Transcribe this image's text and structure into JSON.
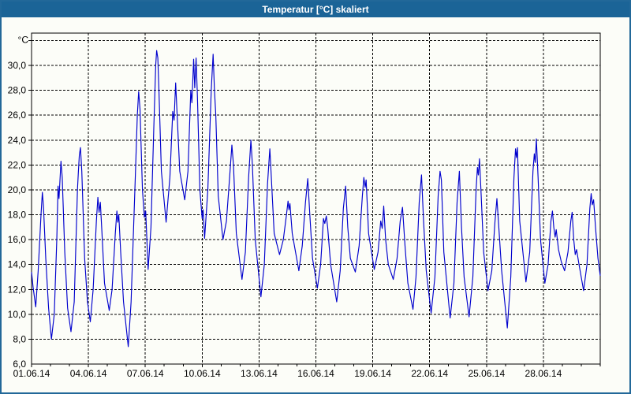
{
  "window": {
    "title": "Temperatur [°C] skaliert",
    "colors": {
      "titlebar": "#1B6497",
      "border": "#226899",
      "background": "#FCFDF8",
      "title_text": "#FFFFFF"
    }
  },
  "chart_data": {
    "type": "line",
    "title": "Temperatur [°C] skaliert",
    "grid": {
      "style": "dashed",
      "color": "#000000"
    },
    "x_axis": {
      "tick_labels": [
        "01.06.14",
        "04.06.14",
        "07.06.14",
        "10.06.14",
        "13.06.14",
        "16.06.14",
        "19.06.14",
        "22.06.14",
        "25.06.14",
        "28.06.14"
      ],
      "tick_days": [
        0,
        3,
        6,
        9,
        12,
        15,
        18,
        21,
        24,
        27
      ],
      "minor_tick_every_days": 1,
      "range_days": [
        0,
        30
      ]
    },
    "y_axis": {
      "unit": "°C",
      "tick_labels": [
        "30,0",
        "28,0",
        "26,0",
        "24,0",
        "22,0",
        "20,0",
        "18,0",
        "16,0",
        "14,0",
        "12,0",
        "10,0",
        "8,0",
        "6,0"
      ],
      "tick_values": [
        30,
        28,
        26,
        24,
        22,
        20,
        18,
        16,
        14,
        12,
        10,
        8,
        6
      ],
      "gridline_values": [
        8,
        10,
        12,
        14,
        16,
        18,
        20,
        22,
        24,
        26,
        28,
        30,
        32
      ],
      "range": [
        6,
        32.6
      ]
    },
    "series": [
      {
        "name": "Temperatur",
        "color": "#0000CD",
        "points": [
          [
            0.0,
            13.4
          ],
          [
            0.08,
            12.2
          ],
          [
            0.22,
            10.6
          ],
          [
            0.35,
            13.5
          ],
          [
            0.5,
            18.0
          ],
          [
            0.57,
            19.8
          ],
          [
            0.63,
            18.7
          ],
          [
            0.75,
            14.5
          ],
          [
            0.9,
            10.5
          ],
          [
            1.05,
            8.0
          ],
          [
            1.2,
            10.0
          ],
          [
            1.33,
            16.0
          ],
          [
            1.4,
            20.3
          ],
          [
            1.45,
            19.3
          ],
          [
            1.55,
            22.3
          ],
          [
            1.62,
            21.0
          ],
          [
            1.75,
            15.0
          ],
          [
            1.9,
            10.5
          ],
          [
            2.08,
            8.6
          ],
          [
            2.25,
            11.0
          ],
          [
            2.42,
            20.0
          ],
          [
            2.47,
            21.5
          ],
          [
            2.52,
            22.8
          ],
          [
            2.58,
            23.4
          ],
          [
            2.65,
            21.5
          ],
          [
            2.8,
            14.5
          ],
          [
            2.95,
            11.0
          ],
          [
            3.1,
            9.4
          ],
          [
            3.25,
            12.0
          ],
          [
            3.42,
            17.5
          ],
          [
            3.5,
            19.4
          ],
          [
            3.56,
            18.2
          ],
          [
            3.63,
            19.0
          ],
          [
            3.7,
            17.0
          ],
          [
            3.85,
            12.5
          ],
          [
            4.1,
            10.3
          ],
          [
            4.25,
            12.0
          ],
          [
            4.42,
            16.5
          ],
          [
            4.5,
            18.3
          ],
          [
            4.55,
            17.4
          ],
          [
            4.6,
            18.0
          ],
          [
            4.7,
            15.0
          ],
          [
            4.85,
            11.0
          ],
          [
            5.1,
            7.4
          ],
          [
            5.25,
            11.0
          ],
          [
            5.45,
            20.0
          ],
          [
            5.58,
            26.0
          ],
          [
            5.65,
            27.9
          ],
          [
            5.72,
            26.5
          ],
          [
            5.85,
            20.0
          ],
          [
            5.95,
            17.8
          ],
          [
            6.02,
            18.3
          ],
          [
            6.15,
            13.6
          ],
          [
            6.3,
            17.0
          ],
          [
            6.45,
            25.0
          ],
          [
            6.55,
            30.0
          ],
          [
            6.6,
            31.2
          ],
          [
            6.66,
            30.6
          ],
          [
            6.72,
            28.0
          ],
          [
            6.85,
            21.5
          ],
          [
            7.1,
            17.4
          ],
          [
            7.3,
            21.0
          ],
          [
            7.45,
            26.3
          ],
          [
            7.52,
            25.6
          ],
          [
            7.6,
            28.6
          ],
          [
            7.68,
            26.0
          ],
          [
            7.82,
            21.5
          ],
          [
            8.08,
            19.2
          ],
          [
            8.25,
            21.5
          ],
          [
            8.4,
            28.0
          ],
          [
            8.46,
            27.0
          ],
          [
            8.55,
            30.5
          ],
          [
            8.61,
            28.2
          ],
          [
            8.68,
            30.6
          ],
          [
            8.75,
            27.5
          ],
          [
            8.88,
            20.0
          ],
          [
            9.0,
            17.7
          ],
          [
            9.05,
            18.4
          ],
          [
            9.13,
            16.1
          ],
          [
            9.3,
            20.0
          ],
          [
            9.48,
            28.0
          ],
          [
            9.58,
            30.9
          ],
          [
            9.65,
            28.0
          ],
          [
            9.72,
            26.0
          ],
          [
            9.85,
            19.5
          ],
          [
            10.1,
            16.0
          ],
          [
            10.28,
            17.5
          ],
          [
            10.45,
            21.0
          ],
          [
            10.57,
            23.6
          ],
          [
            10.65,
            22.0
          ],
          [
            10.8,
            16.5
          ],
          [
            11.1,
            12.8
          ],
          [
            11.28,
            15.0
          ],
          [
            11.45,
            21.0
          ],
          [
            11.57,
            24.0
          ],
          [
            11.65,
            22.0
          ],
          [
            11.8,
            16.0
          ],
          [
            12.1,
            11.4
          ],
          [
            12.28,
            14.0
          ],
          [
            12.45,
            20.5
          ],
          [
            12.57,
            23.3
          ],
          [
            12.65,
            21.0
          ],
          [
            12.8,
            16.5
          ],
          [
            13.08,
            14.8
          ],
          [
            13.28,
            16.0
          ],
          [
            13.45,
            18.0
          ],
          [
            13.53,
            19.1
          ],
          [
            13.58,
            18.4
          ],
          [
            13.63,
            18.9
          ],
          [
            13.75,
            16.5
          ],
          [
            14.1,
            13.5
          ],
          [
            14.28,
            15.5
          ],
          [
            14.45,
            19.0
          ],
          [
            14.57,
            20.9
          ],
          [
            14.68,
            18.0
          ],
          [
            14.82,
            14.5
          ],
          [
            15.08,
            12.1
          ],
          [
            15.25,
            14.0
          ],
          [
            15.4,
            17.7
          ],
          [
            15.47,
            17.3
          ],
          [
            15.55,
            17.9
          ],
          [
            15.62,
            17.0
          ],
          [
            15.78,
            14.0
          ],
          [
            16.1,
            11.0
          ],
          [
            16.28,
            13.5
          ],
          [
            16.45,
            18.5
          ],
          [
            16.57,
            20.3
          ],
          [
            16.68,
            17.0
          ],
          [
            16.82,
            14.5
          ],
          [
            17.08,
            13.4
          ],
          [
            17.28,
            15.5
          ],
          [
            17.45,
            19.5
          ],
          [
            17.53,
            21.0
          ],
          [
            17.6,
            20.2
          ],
          [
            17.65,
            20.8
          ],
          [
            17.78,
            16.5
          ],
          [
            18.08,
            13.6
          ],
          [
            18.28,
            15.0
          ],
          [
            18.42,
            17.5
          ],
          [
            18.5,
            16.9
          ],
          [
            18.58,
            18.7
          ],
          [
            18.68,
            16.0
          ],
          [
            18.82,
            14.0
          ],
          [
            19.08,
            12.8
          ],
          [
            19.28,
            14.5
          ],
          [
            19.45,
            17.5
          ],
          [
            19.57,
            18.6
          ],
          [
            19.7,
            15.5
          ],
          [
            19.85,
            12.5
          ],
          [
            20.12,
            10.4
          ],
          [
            20.28,
            13.0
          ],
          [
            20.45,
            19.0
          ],
          [
            20.57,
            21.2
          ],
          [
            20.68,
            17.5
          ],
          [
            20.82,
            13.5
          ],
          [
            21.08,
            10.1
          ],
          [
            21.28,
            13.0
          ],
          [
            21.45,
            19.5
          ],
          [
            21.55,
            21.5
          ],
          [
            21.62,
            20.8
          ],
          [
            21.75,
            15.0
          ],
          [
            22.08,
            9.7
          ],
          [
            22.28,
            12.5
          ],
          [
            22.45,
            19.0
          ],
          [
            22.57,
            21.5
          ],
          [
            22.68,
            17.0
          ],
          [
            22.82,
            13.0
          ],
          [
            23.08,
            9.8
          ],
          [
            23.28,
            13.0
          ],
          [
            23.45,
            20.0
          ],
          [
            23.52,
            21.8
          ],
          [
            23.57,
            21.2
          ],
          [
            23.63,
            22.5
          ],
          [
            23.72,
            19.5
          ],
          [
            23.85,
            15.0
          ],
          [
            24.08,
            11.9
          ],
          [
            24.28,
            13.5
          ],
          [
            24.45,
            17.5
          ],
          [
            24.55,
            19.3
          ],
          [
            24.65,
            17.0
          ],
          [
            24.8,
            13.5
          ],
          [
            25.1,
            8.9
          ],
          [
            25.28,
            13.0
          ],
          [
            25.45,
            21.0
          ],
          [
            25.53,
            23.3
          ],
          [
            25.58,
            22.6
          ],
          [
            25.63,
            23.4
          ],
          [
            25.75,
            17.5
          ],
          [
            26.08,
            12.6
          ],
          [
            26.28,
            15.0
          ],
          [
            26.45,
            21.5
          ],
          [
            26.52,
            22.9
          ],
          [
            26.57,
            22.2
          ],
          [
            26.63,
            24.1
          ],
          [
            26.72,
            21.0
          ],
          [
            26.85,
            16.0
          ],
          [
            27.08,
            12.5
          ],
          [
            27.25,
            14.0
          ],
          [
            27.4,
            17.5
          ],
          [
            27.48,
            18.3
          ],
          [
            27.55,
            17.0
          ],
          [
            27.62,
            16.2
          ],
          [
            27.68,
            16.8
          ],
          [
            27.8,
            15.2
          ],
          [
            27.95,
            14.2
          ],
          [
            28.12,
            13.5
          ],
          [
            28.3,
            15.0
          ],
          [
            28.45,
            17.5
          ],
          [
            28.52,
            18.2
          ],
          [
            28.6,
            16.0
          ],
          [
            28.68,
            14.8
          ],
          [
            28.75,
            15.2
          ],
          [
            28.88,
            14.0
          ],
          [
            29.12,
            11.9
          ],
          [
            29.3,
            14.0
          ],
          [
            29.45,
            18.5
          ],
          [
            29.52,
            19.7
          ],
          [
            29.58,
            18.8
          ],
          [
            29.65,
            19.2
          ],
          [
            29.75,
            17.0
          ],
          [
            29.88,
            14.5
          ],
          [
            30.0,
            13.1
          ]
        ]
      }
    ]
  }
}
